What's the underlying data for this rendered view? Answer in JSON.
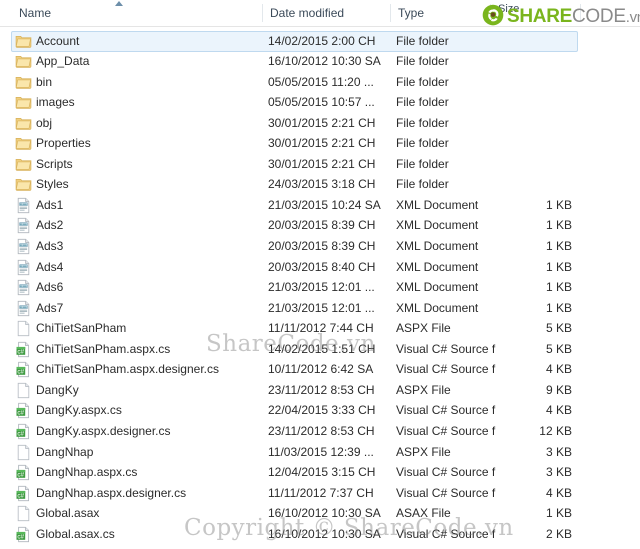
{
  "window": {
    "view": "details"
  },
  "columns": [
    {
      "key": "name",
      "label": "Name",
      "sorted": "asc"
    },
    {
      "key": "date",
      "label": "Date modified",
      "sorted": "none"
    },
    {
      "key": "type",
      "label": "Type",
      "sorted": "none"
    },
    {
      "key": "size",
      "label": "Size",
      "sorted": "none"
    }
  ],
  "watermarks": {
    "logo_share": "SHARE",
    "logo_code": "CODE",
    "logo_vn": ".vn",
    "middle": "ShareCode.vn",
    "bottom": "Copyright © ShareCode.vn"
  },
  "colors": {
    "logo_green": "#7ab51d",
    "logo_gray": "#8a8a8a",
    "selection_fill": "#ebf4fc",
    "selection_border": "#bfd9ef",
    "folder_icon": "#f5d98a",
    "csharp_icon": "#3f9b42"
  },
  "rows": [
    {
      "name": "Account",
      "date": "14/02/2015 2:00 CH",
      "type": "File folder",
      "size": "",
      "icon": "folder-icon",
      "selected": true
    },
    {
      "name": "App_Data",
      "date": "16/10/2012 10:30 SA",
      "type": "File folder",
      "size": "",
      "icon": "folder-icon",
      "selected": false
    },
    {
      "name": "bin",
      "date": "05/05/2015 11:20 ...",
      "type": "File folder",
      "size": "",
      "icon": "folder-icon",
      "selected": false
    },
    {
      "name": "images",
      "date": "05/05/2015 10:57 ...",
      "type": "File folder",
      "size": "",
      "icon": "folder-icon",
      "selected": false
    },
    {
      "name": "obj",
      "date": "30/01/2015 2:21 CH",
      "type": "File folder",
      "size": "",
      "icon": "folder-icon",
      "selected": false
    },
    {
      "name": "Properties",
      "date": "30/01/2015 2:21 CH",
      "type": "File folder",
      "size": "",
      "icon": "folder-icon",
      "selected": false
    },
    {
      "name": "Scripts",
      "date": "30/01/2015 2:21 CH",
      "type": "File folder",
      "size": "",
      "icon": "folder-icon",
      "selected": false
    },
    {
      "name": "Styles",
      "date": "24/03/2015 3:18 CH",
      "type": "File folder",
      "size": "",
      "icon": "folder-icon",
      "selected": false
    },
    {
      "name": "Ads1",
      "date": "21/03/2015 10:24 SA",
      "type": "XML Document",
      "size": "1 KB",
      "icon": "xml-file-icon",
      "selected": false
    },
    {
      "name": "Ads2",
      "date": "20/03/2015 8:39 CH",
      "type": "XML Document",
      "size": "1 KB",
      "icon": "xml-file-icon",
      "selected": false
    },
    {
      "name": "Ads3",
      "date": "20/03/2015 8:39 CH",
      "type": "XML Document",
      "size": "1 KB",
      "icon": "xml-file-icon",
      "selected": false
    },
    {
      "name": "Ads4",
      "date": "20/03/2015 8:40 CH",
      "type": "XML Document",
      "size": "1 KB",
      "icon": "xml-file-icon",
      "selected": false
    },
    {
      "name": "Ads6",
      "date": "21/03/2015 12:01 ...",
      "type": "XML Document",
      "size": "1 KB",
      "icon": "xml-file-icon",
      "selected": false
    },
    {
      "name": "Ads7",
      "date": "21/03/2015 12:01 ...",
      "type": "XML Document",
      "size": "1 KB",
      "icon": "xml-file-icon",
      "selected": false
    },
    {
      "name": "ChiTietSanPham",
      "date": "11/11/2012 7:44 CH",
      "type": "ASPX File",
      "size": "5 KB",
      "icon": "blank-page-icon",
      "selected": false
    },
    {
      "name": "ChiTietSanPham.aspx.cs",
      "date": "14/02/2015 1:51 CH",
      "type": "Visual C# Source f...",
      "size": "5 KB",
      "icon": "csharp-file-icon",
      "selected": false
    },
    {
      "name": "ChiTietSanPham.aspx.designer.cs",
      "date": "10/11/2012 6:42 SA",
      "type": "Visual C# Source f...",
      "size": "4 KB",
      "icon": "csharp-file-icon",
      "selected": false
    },
    {
      "name": "DangKy",
      "date": "23/11/2012 8:53 CH",
      "type": "ASPX File",
      "size": "9 KB",
      "icon": "blank-page-icon",
      "selected": false
    },
    {
      "name": "DangKy.aspx.cs",
      "date": "22/04/2015 3:33 CH",
      "type": "Visual C# Source f...",
      "size": "4 KB",
      "icon": "csharp-file-icon",
      "selected": false
    },
    {
      "name": "DangKy.aspx.designer.cs",
      "date": "23/11/2012 8:53 CH",
      "type": "Visual C# Source f...",
      "size": "12 KB",
      "icon": "csharp-file-icon",
      "selected": false
    },
    {
      "name": "DangNhap",
      "date": "11/03/2015 12:39 ...",
      "type": "ASPX File",
      "size": "3 KB",
      "icon": "blank-page-icon",
      "selected": false
    },
    {
      "name": "DangNhap.aspx.cs",
      "date": "12/04/2015 3:15 CH",
      "type": "Visual C# Source f...",
      "size": "3 KB",
      "icon": "csharp-file-icon",
      "selected": false
    },
    {
      "name": "DangNhap.aspx.designer.cs",
      "date": "11/11/2012 7:37 CH",
      "type": "Visual C# Source f...",
      "size": "4 KB",
      "icon": "csharp-file-icon",
      "selected": false
    },
    {
      "name": "Global.asax",
      "date": "16/10/2012 10:30 SA",
      "type": "ASAX File",
      "size": "1 KB",
      "icon": "blank-page-icon",
      "selected": false
    },
    {
      "name": "Global.asax.cs",
      "date": "16/10/2012 10:30 SA",
      "type": "Visual C# Source f...",
      "size": "2 KB",
      "icon": "csharp-file-icon",
      "selected": false
    }
  ]
}
